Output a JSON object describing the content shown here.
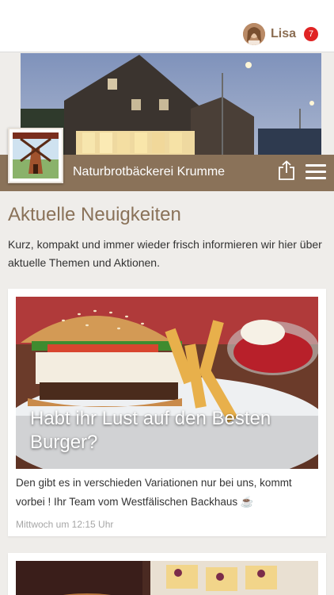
{
  "user": {
    "name": "Lisa",
    "notification_count": "7"
  },
  "brand": {
    "title": "Naturbrotbäckerei Krumme"
  },
  "icons": {
    "share": "share-icon",
    "menu": "hamburger-menu-icon"
  },
  "colors": {
    "brand": "#8a7259",
    "badge": "#e02424",
    "background": "#efedea"
  },
  "page": {
    "title": "Aktuelle Neuigkeiten",
    "intro": "Kurz, kompakt und immer wieder frisch informieren wir hier über aktuelle Themen und Aktionen."
  },
  "news": [
    {
      "title": "Habt ihr Lust auf den Besten Burger?",
      "text": "Den gibt es in verschieden Variationen nur bei uns, kommt vorbei ! Ihr Team vom Westfälischen Backhaus ☕",
      "time": "Mittwoch um 12:15 Uhr"
    }
  ]
}
